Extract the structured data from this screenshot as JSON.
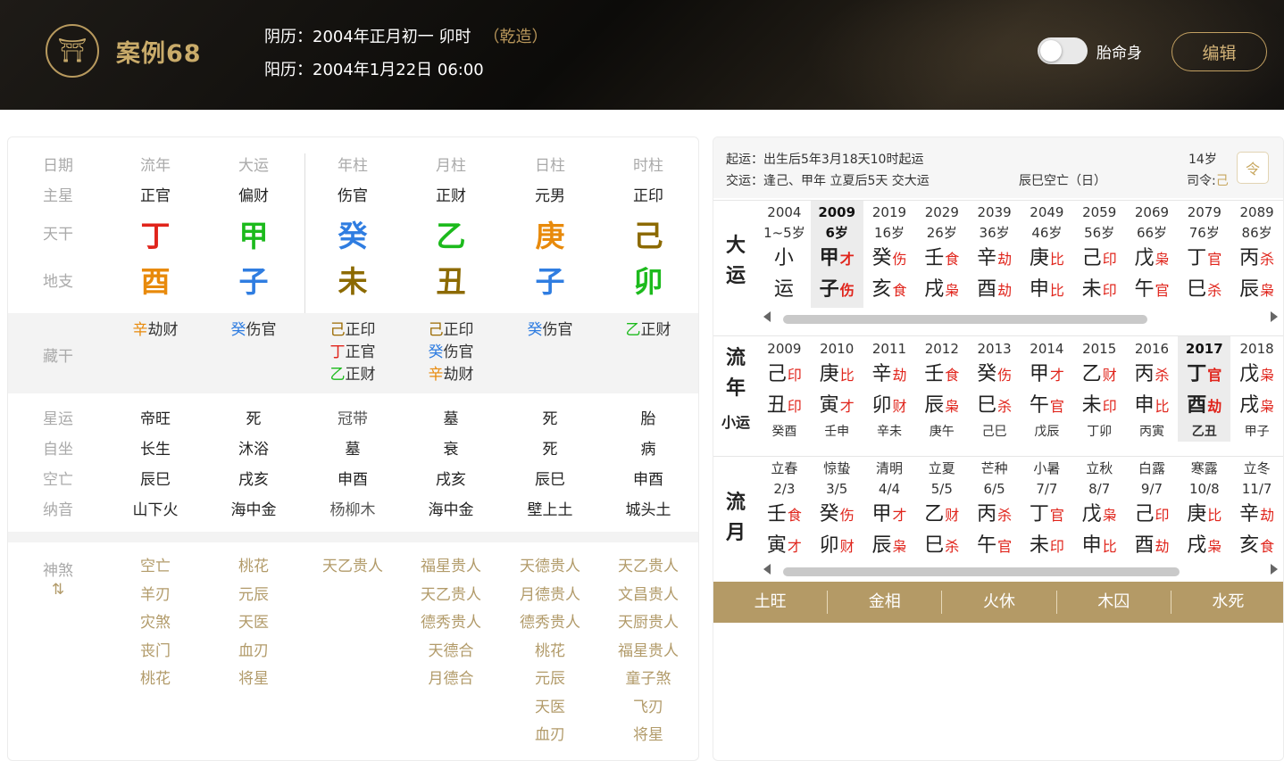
{
  "header": {
    "logo": "⛩",
    "title": "案例68",
    "lunar": "阴历：2004年正月初一 卯时",
    "gender": "（乾造）",
    "solar": "阳历：2004年1月22日 06:00",
    "toggle_label": "胎命身",
    "edit_label": "编辑"
  },
  "left": {
    "labels": {
      "date": "日期",
      "main": "主星",
      "gan": "天干",
      "zhi": "地支",
      "hidden": "藏干",
      "xingyun": "星运",
      "zizuo": "自坐",
      "kongwang": "空亡",
      "nayin": "纳音",
      "shensha": "神煞",
      "shensha_icon": "⇅"
    },
    "columns": [
      {
        "name": "流年",
        "main": "正官",
        "gan": "丁",
        "gan_color": "#e0241b",
        "zhi": "酉",
        "zhi_color": "#e88a0b",
        "hidden": [
          {
            "c": "辛",
            "t": "劫财",
            "color": "#e88a0b"
          }
        ],
        "xingyun": "帝旺",
        "zizuo": "长生",
        "kongwang": "辰巳",
        "nayin": "山下火",
        "shensha": [
          "空亡",
          "羊刃",
          "灾煞",
          "丧门",
          "桃花"
        ]
      },
      {
        "name": "大运",
        "main": "偏财",
        "gan": "甲",
        "gan_color": "#1cba1c",
        "zhi": "子",
        "zhi_color": "#2f7de1",
        "hidden": [
          {
            "c": "癸",
            "t": "伤官",
            "color": "#2f7de1"
          }
        ],
        "xingyun": "死",
        "zizuo": "沐浴",
        "kongwang": "戌亥",
        "nayin": "海中金",
        "shensha": [
          "桃花",
          "元辰",
          "天医",
          "血刃",
          "将星"
        ]
      },
      {
        "name": "年柱",
        "main": "伤官",
        "gan": "癸",
        "gan_color": "#2f7de1",
        "zhi": "未",
        "zhi_color": "#8c6a00",
        "hidden": [
          {
            "c": "己",
            "t": "正印",
            "color": "#9b6a00"
          },
          {
            "c": "丁",
            "t": "正官",
            "color": "#e0241b"
          },
          {
            "c": "乙",
            "t": "正财",
            "color": "#1cba1c"
          }
        ],
        "xingyun": "冠带",
        "zizuo": "墓",
        "kongwang": "申酉",
        "nayin": "杨柳木",
        "shensha": [
          "天乙贵人"
        ]
      },
      {
        "name": "月柱",
        "main": "正财",
        "gan": "乙",
        "gan_color": "#1cba1c",
        "zhi": "丑",
        "zhi_color": "#8c6a00",
        "hidden": [
          {
            "c": "己",
            "t": "正印",
            "color": "#9b6a00"
          },
          {
            "c": "癸",
            "t": "伤官",
            "color": "#2f7de1"
          },
          {
            "c": "辛",
            "t": "劫财",
            "color": "#e88a0b"
          }
        ],
        "xingyun": "墓",
        "zizuo": "衰",
        "kongwang": "戌亥",
        "nayin": "海中金",
        "shensha": [
          "福星贵人",
          "天乙贵人",
          "德秀贵人",
          "天德合",
          "月德合"
        ]
      },
      {
        "name": "日柱",
        "main": "元男",
        "gan": "庚",
        "gan_color": "#e88a0b",
        "zhi": "子",
        "zhi_color": "#2f7de1",
        "hidden": [
          {
            "c": "癸",
            "t": "伤官",
            "color": "#2f7de1"
          }
        ],
        "xingyun": "死",
        "zizuo": "死",
        "kongwang": "辰巳",
        "nayin": "壁上土",
        "shensha": [
          "天德贵人",
          "月德贵人",
          "德秀贵人",
          "桃花",
          "元辰",
          "天医",
          "血刃"
        ]
      },
      {
        "name": "时柱",
        "main": "正印",
        "gan": "己",
        "gan_color": "#8c6a00",
        "zhi": "卯",
        "zhi_color": "#1cba1c",
        "hidden": [
          {
            "c": "乙",
            "t": "正财",
            "color": "#1cba1c"
          }
        ],
        "xingyun": "胎",
        "zizuo": "病",
        "kongwang": "申酉",
        "nayin": "城头土",
        "shensha": [
          "天乙贵人",
          "文昌贵人",
          "天厨贵人",
          "福星贵人",
          "童子煞",
          "飞刃",
          "将星"
        ]
      }
    ]
  },
  "right": {
    "qiyun_label": "起运：",
    "qiyun": "出生后5年3月18天10时起运",
    "jiaoyun_label": "交运：",
    "jiaoyun": "逢己、甲年 立夏后5天 交大运",
    "kongwang": "辰巳空亡（日）",
    "age": "14岁",
    "siling_label": "司令:",
    "siling": "己",
    "cal_icon": "令",
    "dayun": {
      "label": [
        "大",
        "运"
      ],
      "cols": [
        {
          "y1": "2004",
          "y2": "1~5岁",
          "g1": "小",
          "t1": "",
          "g2": "运",
          "t2": "",
          "sel": false
        },
        {
          "y1": "2009",
          "y2": "6岁",
          "g1": "甲",
          "t1": "才",
          "g2": "子",
          "t2": "伤",
          "sel": true
        },
        {
          "y1": "2019",
          "y2": "16岁",
          "g1": "癸",
          "t1": "伤",
          "g2": "亥",
          "t2": "食",
          "sel": false
        },
        {
          "y1": "2029",
          "y2": "26岁",
          "g1": "壬",
          "t1": "食",
          "g2": "戌",
          "t2": "枭",
          "sel": false
        },
        {
          "y1": "2039",
          "y2": "36岁",
          "g1": "辛",
          "t1": "劫",
          "g2": "酉",
          "t2": "劫",
          "sel": false
        },
        {
          "y1": "2049",
          "y2": "46岁",
          "g1": "庚",
          "t1": "比",
          "g2": "申",
          "t2": "比",
          "sel": false
        },
        {
          "y1": "2059",
          "y2": "56岁",
          "g1": "己",
          "t1": "印",
          "g2": "未",
          "t2": "印",
          "sel": false
        },
        {
          "y1": "2069",
          "y2": "66岁",
          "g1": "戊",
          "t1": "枭",
          "g2": "午",
          "t2": "官",
          "sel": false
        },
        {
          "y1": "2079",
          "y2": "76岁",
          "g1": "丁",
          "t1": "官",
          "g2": "巳",
          "t2": "杀",
          "sel": false
        },
        {
          "y1": "2089",
          "y2": "86岁",
          "g1": "丙",
          "t1": "杀",
          "g2": "辰",
          "t2": "枭",
          "sel": false
        }
      ]
    },
    "liunian": {
      "label": [
        "流",
        "年"
      ],
      "sublabel": "小运",
      "cols": [
        {
          "y1": "2009",
          "g1": "己",
          "t1": "印",
          "g2": "丑",
          "t2": "印",
          "sub": "癸酉",
          "sel": false
        },
        {
          "y1": "2010",
          "g1": "庚",
          "t1": "比",
          "g2": "寅",
          "t2": "才",
          "sub": "壬申",
          "sel": false
        },
        {
          "y1": "2011",
          "g1": "辛",
          "t1": "劫",
          "g2": "卯",
          "t2": "财",
          "sub": "辛未",
          "sel": false
        },
        {
          "y1": "2012",
          "g1": "壬",
          "t1": "食",
          "g2": "辰",
          "t2": "枭",
          "sub": "庚午",
          "sel": false
        },
        {
          "y1": "2013",
          "g1": "癸",
          "t1": "伤",
          "g2": "巳",
          "t2": "杀",
          "sub": "己巳",
          "sel": false
        },
        {
          "y1": "2014",
          "g1": "甲",
          "t1": "才",
          "g2": "午",
          "t2": "官",
          "sub": "戊辰",
          "sel": false
        },
        {
          "y1": "2015",
          "g1": "乙",
          "t1": "财",
          "g2": "未",
          "t2": "印",
          "sub": "丁卯",
          "sel": false
        },
        {
          "y1": "2016",
          "g1": "丙",
          "t1": "杀",
          "g2": "申",
          "t2": "比",
          "sub": "丙寅",
          "sel": false
        },
        {
          "y1": "2017",
          "g1": "丁",
          "t1": "官",
          "g2": "酉",
          "t2": "劫",
          "sub": "乙丑",
          "sel": true
        },
        {
          "y1": "2018",
          "g1": "戊",
          "t1": "枭",
          "g2": "戌",
          "t2": "枭",
          "sub": "甲子",
          "sel": false
        }
      ]
    },
    "liuyue": {
      "label": [
        "流",
        "月"
      ],
      "cols": [
        {
          "y1": "立春",
          "y2": "2/3",
          "g1": "壬",
          "t1": "食",
          "g2": "寅",
          "t2": "才"
        },
        {
          "y1": "惊蛰",
          "y2": "3/5",
          "g1": "癸",
          "t1": "伤",
          "g2": "卯",
          "t2": "财"
        },
        {
          "y1": "清明",
          "y2": "4/4",
          "g1": "甲",
          "t1": "才",
          "g2": "辰",
          "t2": "枭"
        },
        {
          "y1": "立夏",
          "y2": "5/5",
          "g1": "乙",
          "t1": "财",
          "g2": "巳",
          "t2": "杀"
        },
        {
          "y1": "芒种",
          "y2": "6/5",
          "g1": "丙",
          "t1": "杀",
          "g2": "午",
          "t2": "官"
        },
        {
          "y1": "小暑",
          "y2": "7/7",
          "g1": "丁",
          "t1": "官",
          "g2": "未",
          "t2": "印"
        },
        {
          "y1": "立秋",
          "y2": "8/7",
          "g1": "戊",
          "t1": "枭",
          "g2": "申",
          "t2": "比"
        },
        {
          "y1": "白露",
          "y2": "9/7",
          "g1": "己",
          "t1": "印",
          "g2": "酉",
          "t2": "劫"
        },
        {
          "y1": "寒露",
          "y2": "10/8",
          "g1": "庚",
          "t1": "比",
          "g2": "戌",
          "t2": "枭"
        },
        {
          "y1": "立冬",
          "y2": "11/7",
          "g1": "辛",
          "t1": "劫",
          "g2": "亥",
          "t2": "食"
        }
      ]
    },
    "wuxing": [
      "土旺",
      "金相",
      "火休",
      "木囚",
      "水死"
    ]
  }
}
